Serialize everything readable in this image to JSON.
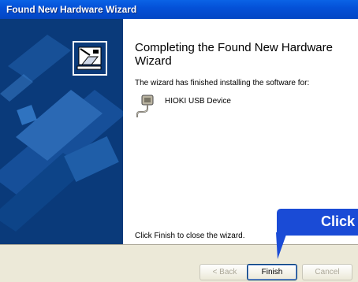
{
  "window": {
    "title": "Found New Hardware Wizard"
  },
  "content": {
    "heading": "Completing the Found New Hardware Wizard",
    "body": "The wizard has finished installing the software for:",
    "device_name": "HIOKI USB Device",
    "close_hint": "Click Finish to close the wizard."
  },
  "buttons": {
    "back": "< Back",
    "finish": "Finish",
    "cancel": "Cancel"
  },
  "callout": {
    "text": "Click"
  },
  "icons": {
    "wizard": "hardware-wizard-icon",
    "device": "usb-device-icon"
  },
  "colors": {
    "titlebar": "#0451d8",
    "left_pane": "#0a3a7a",
    "callout": "#1a4bd6"
  }
}
